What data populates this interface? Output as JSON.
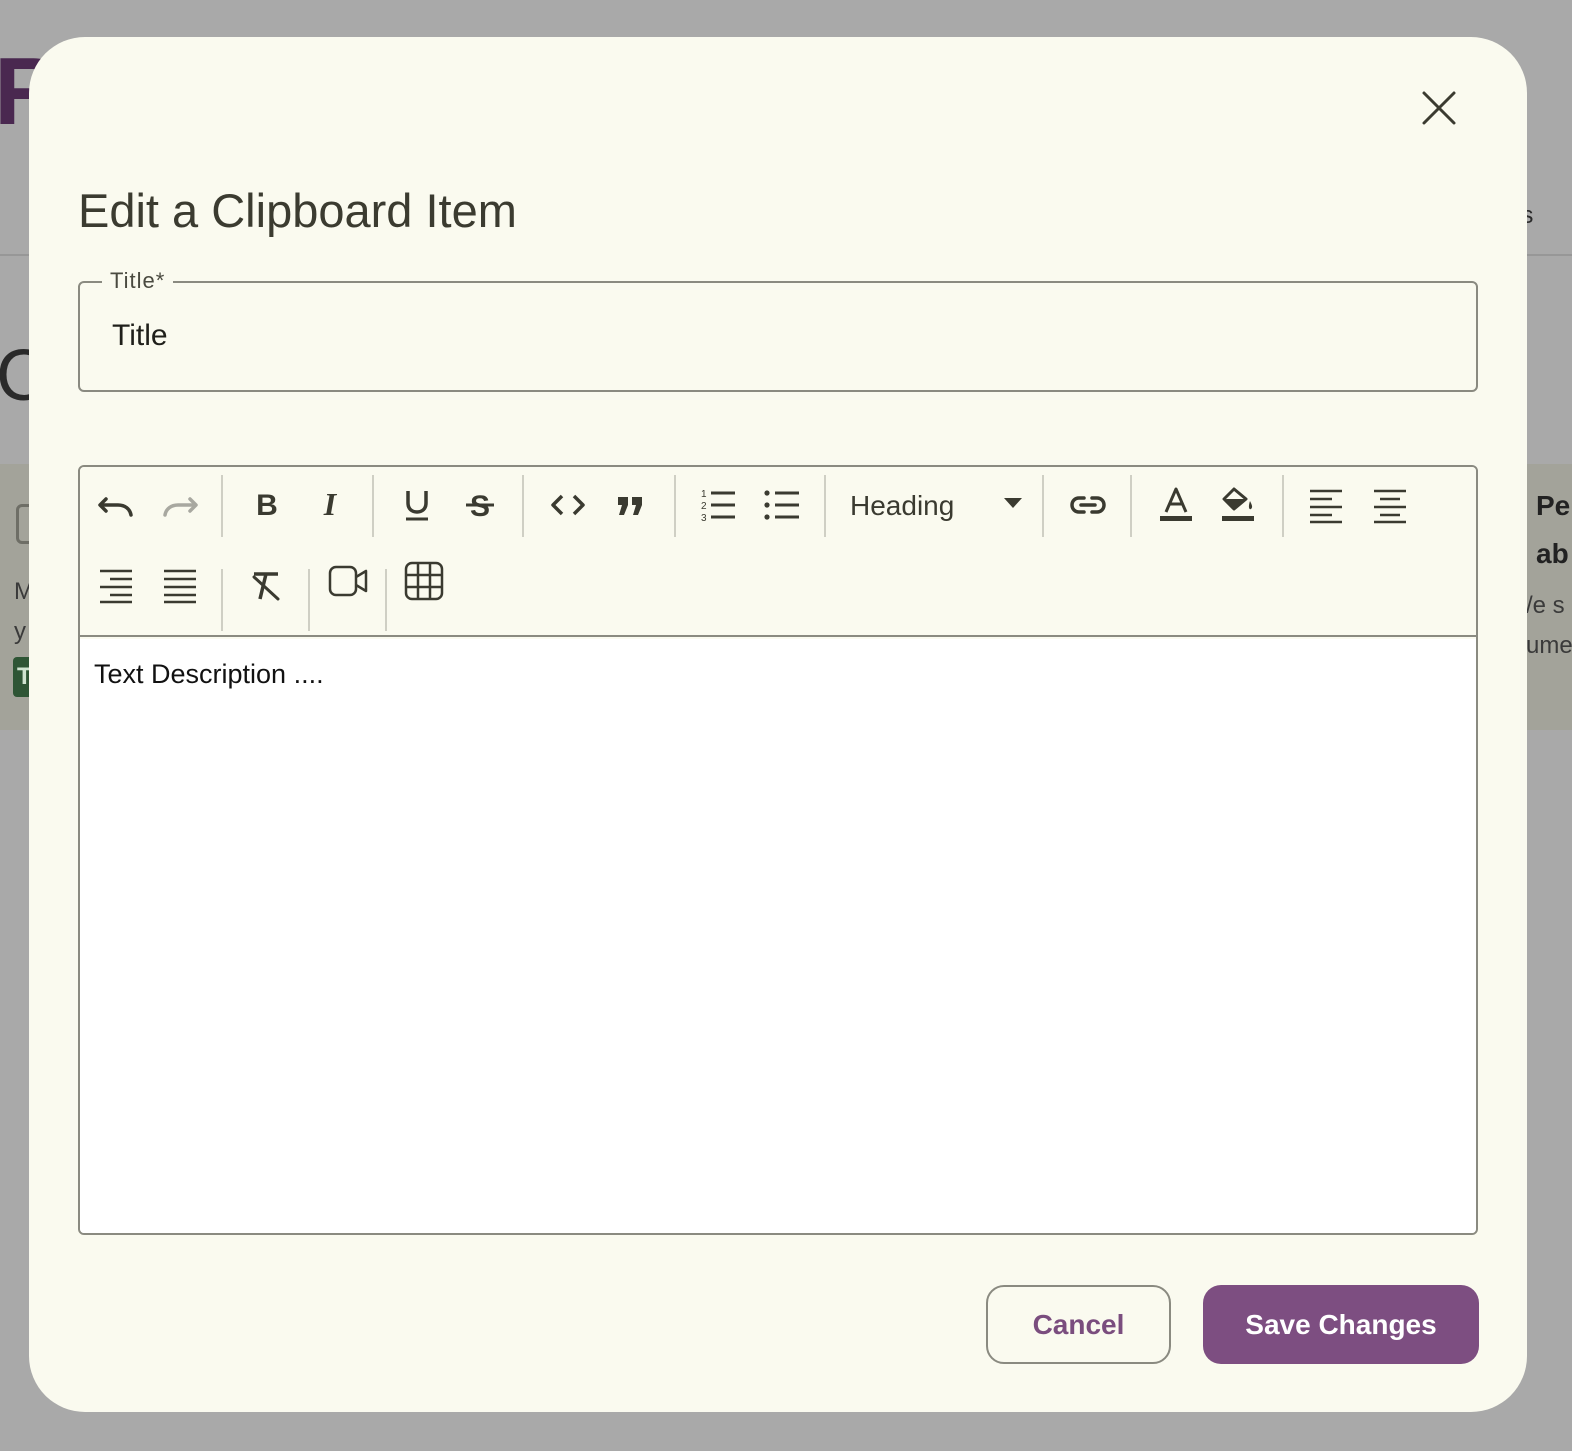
{
  "background": {
    "logo_fragment": "Rc",
    "heading_fragment": "C",
    "nav_fragment": "es",
    "left_card": {
      "line1": "M",
      "line2": "y",
      "badge": "T"
    },
    "right_card": {
      "title_line1": "Pe",
      "title_line2": "ab",
      "text_line1": "/e s",
      "text_line2": "ume"
    }
  },
  "dialog": {
    "title": "Edit a Clipboard Item",
    "title_field": {
      "label": "Title*",
      "value": "Title",
      "placeholder": "Title"
    },
    "toolbar": {
      "heading_select": {
        "value": "Heading"
      },
      "buttons": [
        {
          "name": "undo",
          "icon": "undo-icon"
        },
        {
          "name": "redo",
          "icon": "redo-icon",
          "disabled": true
        },
        {
          "name": "bold",
          "icon": "bold-icon"
        },
        {
          "name": "italic",
          "icon": "italic-icon"
        },
        {
          "name": "underline",
          "icon": "underline-icon"
        },
        {
          "name": "strikethrough",
          "icon": "strikethrough-icon"
        },
        {
          "name": "code",
          "icon": "code-icon"
        },
        {
          "name": "blockquote",
          "icon": "quote-icon"
        },
        {
          "name": "ordered-list",
          "icon": "ordered-list-icon"
        },
        {
          "name": "bullet-list",
          "icon": "bullet-list-icon"
        },
        {
          "name": "link",
          "icon": "link-icon"
        },
        {
          "name": "text-color",
          "icon": "text-color-icon"
        },
        {
          "name": "highlight-color",
          "icon": "paint-bucket-icon"
        },
        {
          "name": "align-left",
          "icon": "align-left-icon"
        },
        {
          "name": "align-center",
          "icon": "align-center-icon"
        },
        {
          "name": "align-right",
          "icon": "align-right-icon"
        },
        {
          "name": "align-justify",
          "icon": "align-justify-icon"
        },
        {
          "name": "clear-format",
          "icon": "clear-format-icon"
        },
        {
          "name": "insert-video",
          "icon": "video-icon"
        },
        {
          "name": "insert-table",
          "icon": "table-icon"
        }
      ]
    },
    "editor_body": "Text Description ....",
    "cancel_label": "Cancel",
    "save_label": "Save Changes"
  },
  "colors": {
    "overlay": "#a9a9a9",
    "dialog_bg": "#fafaef",
    "primary": "#7d4e81",
    "text": "#3b3b30"
  }
}
